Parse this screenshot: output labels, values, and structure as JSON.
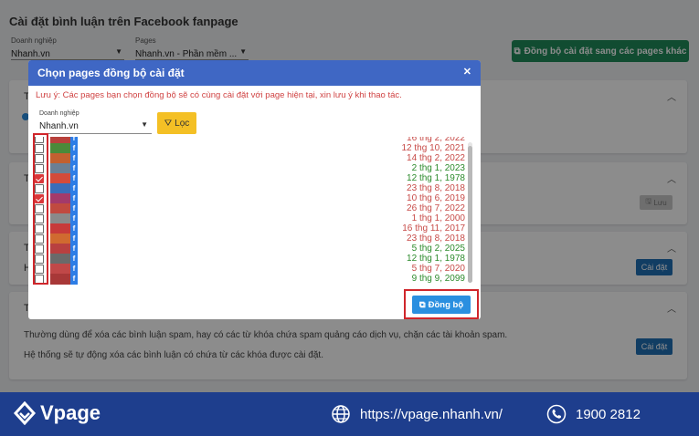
{
  "page": {
    "title": "Cài đặt bình luận trên Facebook fanpage",
    "business_select": {
      "label": "Doanh nghiệp",
      "value": "Nhanh.vn"
    },
    "pages_select": {
      "label": "Pages",
      "value": "Nhanh.vn - Phần mềm ..."
    },
    "sync_other_label": "Đồng bộ cài đặt sang các pages khác",
    "cards": [
      {
        "title": "T",
        "has_radio": true
      },
      {
        "title": "T",
        "action_label": "Lưu"
      },
      {
        "title": "T",
        "sub": "H",
        "action_label": "Cài đặt"
      },
      {
        "title": "T",
        "action_label": "Cài đặt",
        "desc1": "Thường dùng để xóa các bình luận spam, hay có các từ khóa chứa spam quảng cáo dịch vụ, chặn các tài khoản spam.",
        "desc2": "Hệ thống sẽ tự động xóa các bình luận có chứa từ các khóa được cài đặt."
      }
    ]
  },
  "modal": {
    "title": "Chọn pages đồng bộ cài đặt",
    "close_icon": "close-icon",
    "note": "Lưu ý: Các pages bạn chọn đồng bộ sẽ có cùng cài đặt với page hiện tại, xin lưu ý khi thao tác.",
    "business_select": {
      "label": "Doanh nghiệp",
      "value": "Nhanh.vn"
    },
    "filter_label": "Lọc",
    "sync_label": "Đồng bộ",
    "rows": [
      {
        "checked": false,
        "date": "16 thg 2, 2022",
        "color": "red"
      },
      {
        "checked": false,
        "date": "12 thg 10, 2021",
        "color": "red"
      },
      {
        "checked": false,
        "date": "14 thg 2, 2022",
        "color": "red"
      },
      {
        "checked": false,
        "date": "2 thg 1, 2023",
        "color": "green"
      },
      {
        "checked": true,
        "date": "12 thg 1, 1978",
        "color": "green"
      },
      {
        "checked": false,
        "date": "23 thg 8, 2018",
        "color": "red"
      },
      {
        "checked": true,
        "date": "10 thg 6, 2019",
        "color": "red"
      },
      {
        "checked": false,
        "date": "26 thg 7, 2022",
        "color": "red"
      },
      {
        "checked": false,
        "date": "1 thg 1, 2000",
        "color": "red"
      },
      {
        "checked": false,
        "date": "16 thg 11, 2017",
        "color": "red"
      },
      {
        "checked": false,
        "date": "23 thg 8, 2018",
        "color": "red"
      },
      {
        "checked": false,
        "date": "5 thg 2, 2025",
        "color": "green"
      },
      {
        "checked": false,
        "date": "12 thg 1, 1978",
        "color": "green"
      },
      {
        "checked": false,
        "date": "5 thg 7, 2020",
        "color": "red"
      },
      {
        "checked": false,
        "date": "9 thg 9, 2099",
        "color": "green"
      }
    ]
  },
  "footer": {
    "brand": "Vpage",
    "website": "https://vpage.nhanh.vn/",
    "phone": "1900 2812"
  },
  "colors": {
    "header_blue": "#3f67c4",
    "footer_blue": "#1e3e8d",
    "sync_green": "#1f8a5a",
    "filter_yellow": "#f4c025",
    "highlight_red": "#d0262b"
  }
}
